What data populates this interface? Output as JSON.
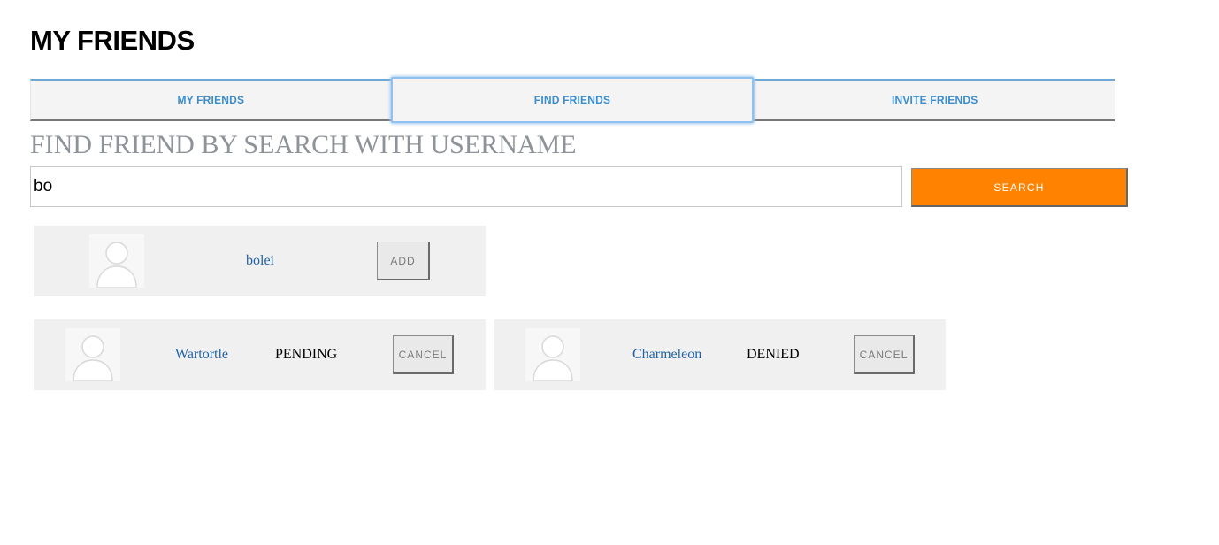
{
  "page": {
    "title": "MY FRIENDS"
  },
  "tabs": [
    {
      "label": "MY FRIENDS",
      "active": false
    },
    {
      "label": "FIND FRIENDS",
      "active": true
    },
    {
      "label": "INVITE FRIENDS",
      "active": false
    }
  ],
  "search": {
    "heading": "FIND FRIEND BY SEARCH WITH USERNAME",
    "value": "bo",
    "button_label": "SEARCH",
    "button_color": "#ff8200"
  },
  "results": [
    {
      "username": "bolei",
      "status": "",
      "button_label": "ADD",
      "avatar_icon": "user-avatar-icon"
    }
  ],
  "requests": [
    {
      "username": "Wartortle",
      "status": "PENDING",
      "button_label": "CANCEL",
      "avatar_icon": "user-avatar-icon"
    },
    {
      "username": "Charmeleon",
      "status": "DENIED",
      "button_label": "CANCEL",
      "avatar_icon": "user-avatar-icon"
    }
  ],
  "colors": {
    "link": "#1f63a8",
    "tab_text": "#3a8dcf",
    "card_bg": "#f1f0f0"
  }
}
